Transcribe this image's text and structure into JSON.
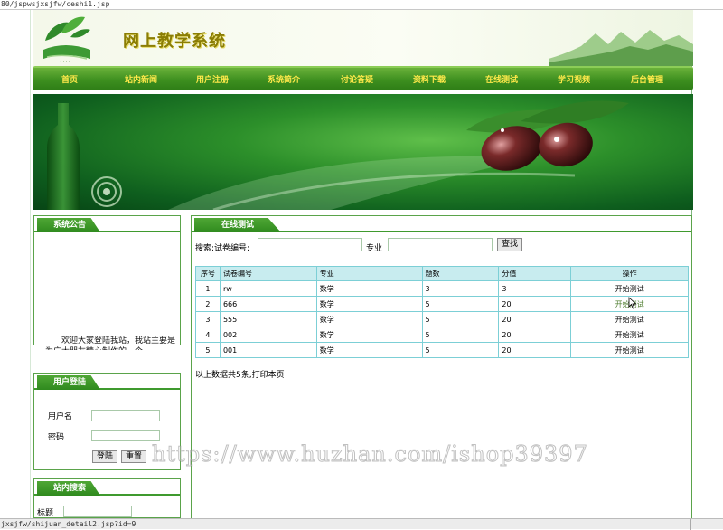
{
  "browser": {
    "url_fragment": "80/jspwsjxsjfw/ceshi1.jsp",
    "status_url": "jxsjfw/shijuan_detail2.jsp?id=9"
  },
  "header": {
    "site_title": "网上教学系统"
  },
  "nav": {
    "items": [
      "首页",
      "站内新闻",
      "用户注册",
      "系统简介",
      "讨论答疑",
      "资料下载",
      "在线测试",
      "学习视频",
      "后台管理"
    ]
  },
  "notice": {
    "title": "系统公告",
    "text": "欢迎大家登陆我站，我站主要是为广大朋友精心制作的一个"
  },
  "login": {
    "title": "用户登陆",
    "username_label": "用户名",
    "password_label": "密码",
    "login_button": "登陆",
    "reset_button": "重置"
  },
  "site_search": {
    "title": "站内搜索",
    "title_label": "标题"
  },
  "test": {
    "title": "在线测试",
    "search_label": "搜索:试卷编号:",
    "major_label": "专业",
    "search_button": "查找",
    "columns": [
      "序号",
      "试卷编号",
      "专业",
      "题数",
      "分值",
      "操作"
    ],
    "rows": [
      {
        "idx": "1",
        "code": "rw",
        "major": "数学",
        "count": "3",
        "score": "3",
        "op": "开始测试"
      },
      {
        "idx": "2",
        "code": "666",
        "major": "数学",
        "count": "5",
        "score": "20",
        "op": "开始测试"
      },
      {
        "idx": "3",
        "code": "555",
        "major": "数学",
        "count": "5",
        "score": "20",
        "op": "开始测试"
      },
      {
        "idx": "4",
        "code": "002",
        "major": "数学",
        "count": "5",
        "score": "20",
        "op": "开始测试"
      },
      {
        "idx": "5",
        "code": "001",
        "major": "数学",
        "count": "5",
        "score": "20",
        "op": "开始测试"
      }
    ],
    "footer_text": "以上数据共5条,",
    "print_link": "打印本页"
  },
  "watermark": "https://www.huzhan.com/ishop39397",
  "colors": {
    "nav_green": "#3d8f1f",
    "nav_text": "#ffe94a",
    "title_olive": "#8a7d05",
    "table_header": "#c8ecef",
    "table_border": "#7ccfd6"
  }
}
